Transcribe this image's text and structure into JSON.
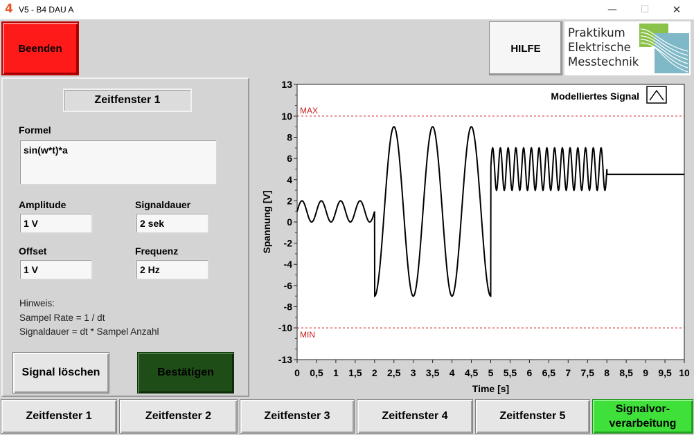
{
  "window": {
    "app_icon": "4",
    "title": "V5 - B4 DAU A",
    "minimize_glyph": "—",
    "maximize_glyph": "☐",
    "close_glyph": "✕"
  },
  "header": {
    "beenden_label": "Beenden",
    "hilfe_label": "HILFE",
    "logo_lines": [
      "Praktikum",
      "Elektrische",
      "Messtechnik"
    ]
  },
  "editor": {
    "zeitfenster_title": "Zeitfenster 1",
    "formel_label": "Formel",
    "formel_value": "sin(w*t)*a",
    "amplitude_label": "Amplitude",
    "amplitude_value": "1 V",
    "signaldauer_label": "Signaldauer",
    "signaldauer_value": "2 sek",
    "offset_label": "Offset",
    "offset_value": "1 V",
    "frequenz_label": "Frequenz",
    "frequenz_value": "2 Hz",
    "hint_lines": [
      "Hinweis:",
      "Sampel Rate = 1 / dt",
      "Signaldauer = dt * Sampel Anzahl"
    ],
    "signal_loeschen_label": "Signal löschen",
    "bestaetigen_label": "Bestätigen"
  },
  "tabs": [
    {
      "label": "Zeitfenster 1"
    },
    {
      "label": "Zeitfenster 2"
    },
    {
      "label": "Zeitfenster 3"
    },
    {
      "label": "Zeitfenster 4"
    },
    {
      "label": "Zeitfenster 5"
    },
    {
      "label_line1": "Signalvor-",
      "label_line2": "verarbeitung",
      "active": true
    }
  ],
  "colors": {
    "accent_red": "#ff1a1a",
    "confirm_green": "#1f4d17",
    "active_tab_green": "#3fe03a",
    "limit_line": "#cc1a1a"
  },
  "chart_data": {
    "type": "line",
    "xlabel": "Time [s]",
    "ylabel": "Spannung [V]",
    "xlim": [
      0,
      10
    ],
    "ylim": [
      -13,
      13
    ],
    "x_ticks": [
      0,
      0.5,
      1,
      1.5,
      2,
      2.5,
      3,
      3.5,
      4,
      4.5,
      5,
      5.5,
      6,
      6.5,
      7,
      7.5,
      8,
      8.5,
      9,
      9.5,
      10
    ],
    "x_tick_labels": [
      "0",
      "0,5",
      "1",
      "1,5",
      "2",
      "2,5",
      "3",
      "3,5",
      "4",
      "4,5",
      "5",
      "5,5",
      "6",
      "6,5",
      "7",
      "7,5",
      "8",
      "8,5",
      "9",
      "9,5",
      "10"
    ],
    "y_ticks": [
      13,
      10,
      8,
      6,
      4,
      2,
      0,
      -2,
      -4,
      -6,
      -8,
      -10,
      -13
    ],
    "y_tick_labels": [
      "13",
      "10",
      "8",
      "6",
      "4",
      "2",
      "0",
      "-2",
      "-4",
      "-6",
      "-8",
      "-10",
      "-13"
    ],
    "limits": [
      {
        "label": "MAX",
        "value": 10
      },
      {
        "label": "MIN",
        "value": -10
      }
    ],
    "grid": false,
    "legend": {
      "label": "Modelliertes Signal",
      "position": "top-right"
    },
    "segments": [
      {
        "t_start": 0,
        "t_end": 2,
        "formula": "sin",
        "amplitude": 1,
        "offset": 1,
        "frequency": 2
      },
      {
        "t_start": 2,
        "t_end": 5,
        "formula": "sin",
        "amplitude": 8,
        "offset": 1,
        "frequency": 1,
        "phase": -1.5708
      },
      {
        "t_start": 5,
        "t_end": 8,
        "formula": "sin",
        "amplitude": 2,
        "offset": 5,
        "frequency": 5
      },
      {
        "t_start": 8,
        "t_end": 10,
        "formula": "const",
        "offset": 4.5
      }
    ]
  }
}
